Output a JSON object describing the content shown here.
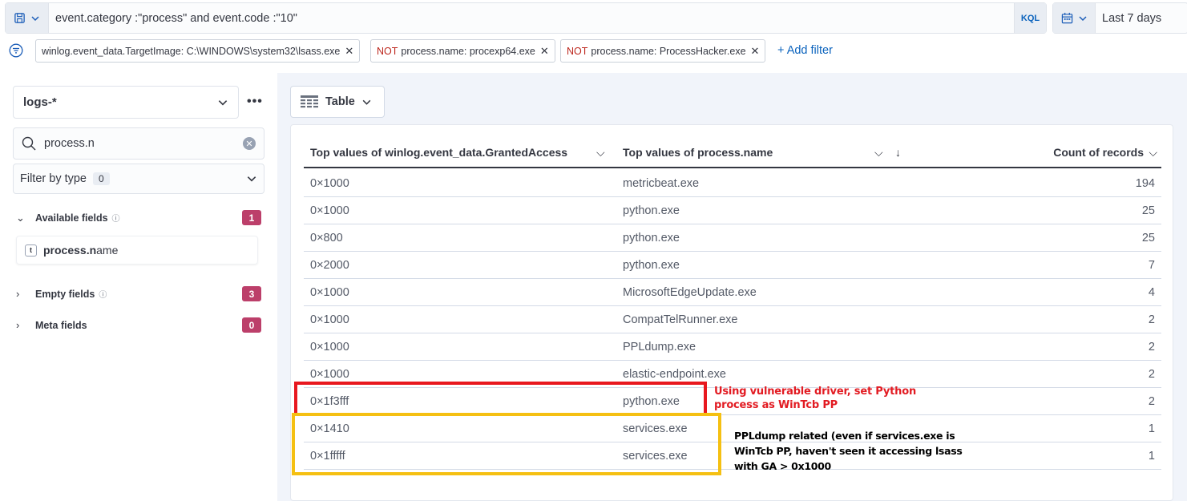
{
  "query": {
    "text": "event.category :\"process\" and event.code :\"10\"",
    "language": "KQL",
    "date_range": "Last 7 days"
  },
  "filters": [
    {
      "negated": false,
      "label": "winlog.event_data.TargetImage: C:\\WINDOWS\\system32\\lsass.exe"
    },
    {
      "negated": true,
      "label": "process.name: procexp64.exe"
    },
    {
      "negated": true,
      "label": "process.name: ProcessHacker.exe"
    }
  ],
  "filter_neg_prefix": "NOT",
  "add_filter_label": "+ Add filter",
  "sidebar": {
    "data_view": "logs-*",
    "search_value": "process.n",
    "filter_by_type_label": "Filter by type",
    "filter_by_type_count": "0",
    "available_fields_label": "Available fields",
    "available_fields_count": "1",
    "field_match": "process.n",
    "field_rest": "ame",
    "empty_fields_label": "Empty fields",
    "empty_fields_count": "3",
    "meta_fields_label": "Meta fields",
    "meta_fields_count": "0"
  },
  "chart_type_label": "Table",
  "table": {
    "columns": [
      "Top values of winlog.event_data.GrantedAccess",
      "Top values of process.name",
      "Count of records"
    ],
    "rows": [
      [
        "0×1000",
        "metricbeat.exe",
        "194"
      ],
      [
        "0×1000",
        "python.exe",
        "25"
      ],
      [
        "0×800",
        "python.exe",
        "25"
      ],
      [
        "0×2000",
        "python.exe",
        "7"
      ],
      [
        "0×1000",
        "MicrosoftEdgeUpdate.exe",
        "4"
      ],
      [
        "0×1000",
        "CompatTelRunner.exe",
        "2"
      ],
      [
        "0×1000",
        "PPLdump.exe",
        "2"
      ],
      [
        "0×1000",
        "elastic-endpoint.exe",
        "2"
      ],
      [
        "0×1f3fff",
        "python.exe",
        "2"
      ],
      [
        "0×1410",
        "services.exe",
        "1"
      ],
      [
        "0×1fffff",
        "services.exe",
        "1"
      ]
    ]
  },
  "annotations": {
    "red_line1": "Using vulnerable driver, set Python",
    "red_line2": "process as WinTcb PP",
    "black_line1": "PPLdump related (even if services.exe is",
    "black_line2": "WinTcb PP, haven't seen it accessing lsass",
    "black_line3": "with GA > 0x1000",
    "colors": {
      "red": "#e8181f",
      "yellow": "#f5c012"
    }
  },
  "colors": {
    "accent": "#0b63bd",
    "badge": "#bc3f6a",
    "negation": "#bd271e"
  }
}
